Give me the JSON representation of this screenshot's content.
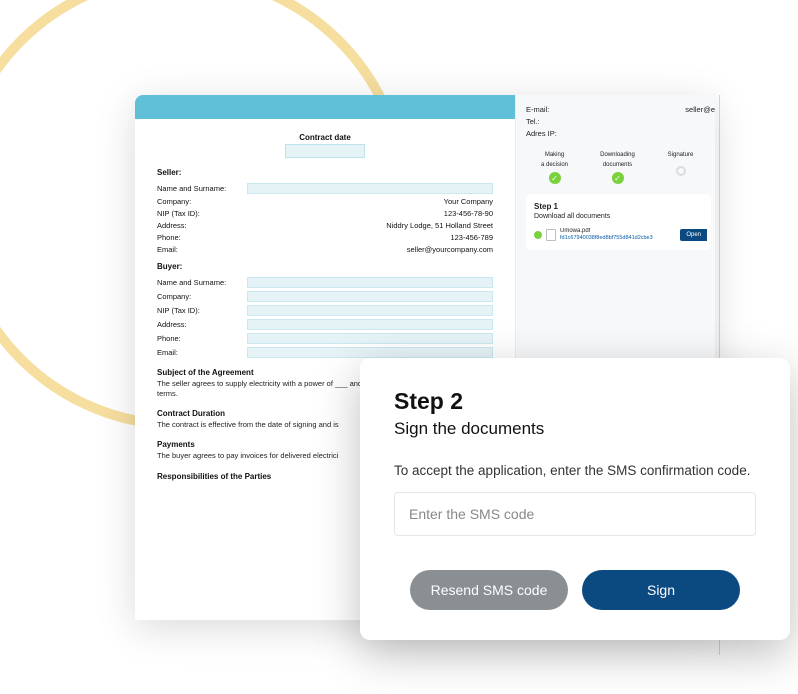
{
  "contract": {
    "title": "Contract date",
    "seller": {
      "label": "Seller:",
      "name_label": "Name and Surname:",
      "company_label": "Company:",
      "company_value": "Your Company",
      "nip_label": "NIP (Tax ID):",
      "nip_value": "123-456-78-90",
      "address_label": "Address:",
      "address_value": "Niddry Lodge, 51 Holland Street",
      "phone_label": "Phone:",
      "phone_value": "123-456-789",
      "email_label": "Email:",
      "email_value": "seller@yourcompany.com"
    },
    "buyer": {
      "label": "Buyer:",
      "name_label": "Name and Surname:",
      "company_label": "Company:",
      "nip_label": "NIP (Tax ID):",
      "address_label": "Address:",
      "phone_label": "Phone:",
      "email_label": "Email:"
    },
    "subject": {
      "title": "Subject of the Agreement",
      "text": "The seller agrees to supply electricity with a power of ___ and pay for it according to the contract terms."
    },
    "duration": {
      "title": "Contract Duration",
      "text": "The contract is effective from the date of signing and is"
    },
    "payments": {
      "title": "Payments",
      "text": "The buyer agrees to pay invoices for delivered electrici"
    },
    "responsibilities": {
      "title": "Responsibilities of the Parties"
    }
  },
  "sidebar": {
    "email_label": "E-mail:",
    "email_value": "seller@e",
    "tel_label": "Tel.:",
    "ip_label": "Adres IP:",
    "steps": [
      {
        "label_line1": "Making",
        "label_line2": "a decision"
      },
      {
        "label_line1": "Downloading",
        "label_line2": "documents"
      },
      {
        "label_line1": "Signature",
        "label_line2": ""
      }
    ],
    "step1": {
      "title": "Step 1",
      "subtitle": "Download all documents",
      "doc_name": "Umowa.pdf",
      "doc_hash": "fd1c67940038f8ed8bf755d841d2cbe3",
      "doc_date": "",
      "open_label": "Open"
    }
  },
  "modal": {
    "title": "Step 2",
    "subtitle": "Sign the documents",
    "description": "To accept the application, enter the SMS confirmation code.",
    "placeholder": "Enter the SMS code",
    "resend_label": "Resend SMS code",
    "sign_label": "Sign"
  }
}
